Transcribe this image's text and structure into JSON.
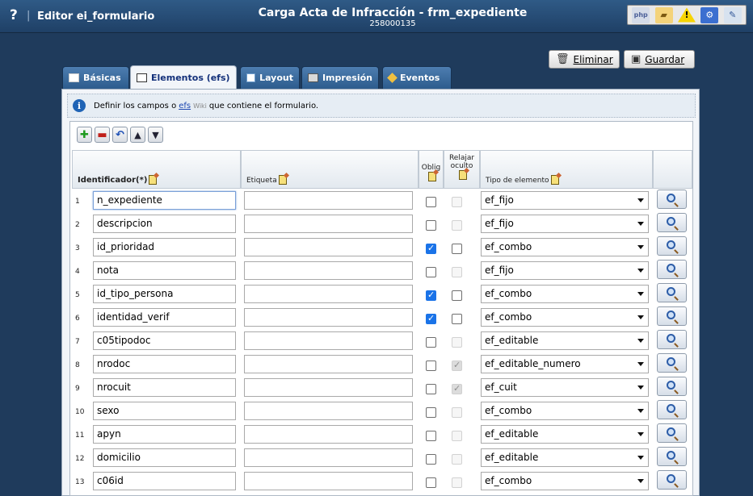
{
  "header": {
    "help": "?",
    "editor_title": "Editor ei_formulario",
    "main_title": "Carga Acta de Infracción - frm_expediente",
    "sub_title": "258000135",
    "toolbar_icons": [
      "php-icon",
      "folder-icon",
      "warning-icon",
      "settings-icon",
      "tools-icon"
    ]
  },
  "actions": {
    "delete_label": "Eliminar",
    "save_label": "Guardar"
  },
  "tabs": [
    {
      "label": "Básicas"
    },
    {
      "label": "Elementos (efs)"
    },
    {
      "label": "Layout"
    },
    {
      "label": "Impresión"
    },
    {
      "label": "Eventos"
    }
  ],
  "info": {
    "before": "Definir los campos o",
    "link": "efs",
    "wiki": "Wiki",
    "after": "que contiene el formulario."
  },
  "columns": {
    "id": "Identificador(*)",
    "etiqueta": "Etiqueta",
    "oblig": "Oblig",
    "relajar": "Relajar",
    "oculto": "oculto",
    "tipo": "Tipo de elemento"
  },
  "rows": [
    {
      "n": "1",
      "id": "n_expediente",
      "etiqueta": "",
      "oblig": false,
      "relajar": false,
      "relajar_enabled": false,
      "tipo": "ef_fijo"
    },
    {
      "n": "2",
      "id": "descripcion",
      "etiqueta": "",
      "oblig": false,
      "relajar": false,
      "relajar_enabled": false,
      "tipo": "ef_fijo"
    },
    {
      "n": "3",
      "id": "id_prioridad",
      "etiqueta": "",
      "oblig": true,
      "relajar": false,
      "relajar_enabled": true,
      "tipo": "ef_combo"
    },
    {
      "n": "4",
      "id": "nota",
      "etiqueta": "",
      "oblig": false,
      "relajar": false,
      "relajar_enabled": false,
      "tipo": "ef_fijo"
    },
    {
      "n": "5",
      "id": "id_tipo_persona",
      "etiqueta": "",
      "oblig": true,
      "relajar": false,
      "relajar_enabled": true,
      "tipo": "ef_combo"
    },
    {
      "n": "6",
      "id": "identidad_verif",
      "etiqueta": "",
      "oblig": true,
      "relajar": false,
      "relajar_enabled": true,
      "tipo": "ef_combo"
    },
    {
      "n": "7",
      "id": "c05tipodoc",
      "etiqueta": "",
      "oblig": false,
      "relajar": false,
      "relajar_enabled": false,
      "tipo": "ef_editable"
    },
    {
      "n": "8",
      "id": "nrodoc",
      "etiqueta": "",
      "oblig": false,
      "relajar": true,
      "relajar_enabled": false,
      "tipo": "ef_editable_numero"
    },
    {
      "n": "9",
      "id": "nrocuit",
      "etiqueta": "",
      "oblig": false,
      "relajar": true,
      "relajar_enabled": false,
      "tipo": "ef_cuit"
    },
    {
      "n": "10",
      "id": "sexo",
      "etiqueta": "",
      "oblig": false,
      "relajar": false,
      "relajar_enabled": false,
      "tipo": "ef_combo"
    },
    {
      "n": "11",
      "id": "apyn",
      "etiqueta": "",
      "oblig": false,
      "relajar": false,
      "relajar_enabled": false,
      "tipo": "ef_editable"
    },
    {
      "n": "12",
      "id": "domicilio",
      "etiqueta": "",
      "oblig": false,
      "relajar": false,
      "relajar_enabled": false,
      "tipo": "ef_editable"
    },
    {
      "n": "13",
      "id": "c06id",
      "etiqueta": "",
      "oblig": false,
      "relajar": false,
      "relajar_enabled": false,
      "tipo": "ef_combo"
    }
  ],
  "colors": {
    "background": "#1f3b5c",
    "tab": "#3a6a9c",
    "checked": "#1a73e8"
  }
}
